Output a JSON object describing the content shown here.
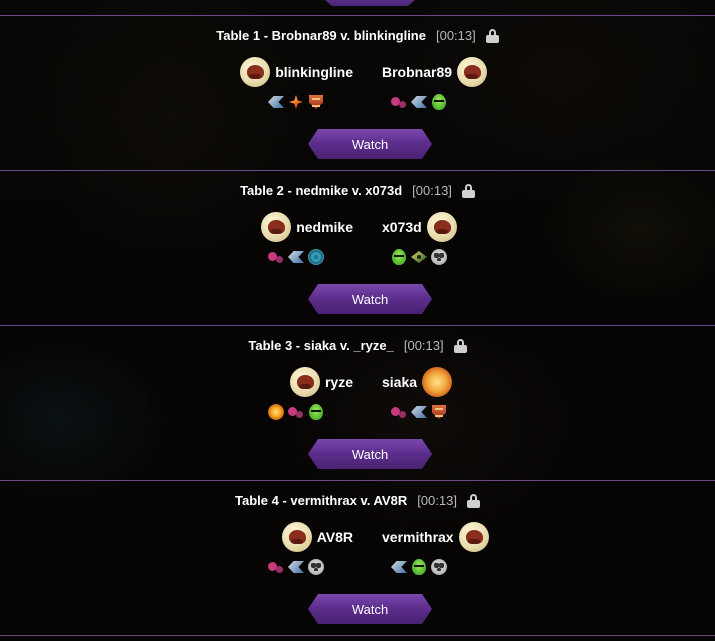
{
  "tables": [
    {
      "title": "Table 1 - Brobnar89 v. blinkingline",
      "timer": "[00:13]",
      "left_player": {
        "name": "blinkingline",
        "factions": [
          "robot",
          "ninja",
          "dino"
        ]
      },
      "right_player": {
        "name": "Brobnar89",
        "factions": [
          "zombie",
          "robot",
          "alien"
        ]
      },
      "watch_label": "Watch"
    },
    {
      "title": "Table 2 - nedmike v. x073d",
      "timer": "[00:13]",
      "left_player": {
        "name": "nedmike",
        "factions": [
          "zombie",
          "robot",
          "spiral"
        ]
      },
      "right_player": {
        "name": "x073d",
        "factions": [
          "alien",
          "eye",
          "ghost"
        ]
      },
      "watch_label": "Watch"
    },
    {
      "title": "Table 3 - siaka v. _ryze_",
      "timer": "[00:13]",
      "left_player": {
        "name": "ryze",
        "factions": [
          "sun",
          "zombie",
          "alien"
        ]
      },
      "right_player": {
        "name": "siaka",
        "factions": [
          "zombie",
          "robot",
          "dino"
        ]
      },
      "watch_label": "Watch"
    },
    {
      "title": "Table 4 - vermithrax v. AV8R",
      "timer": "[00:13]",
      "left_player": {
        "name": "AV8R",
        "factions": [
          "zombie",
          "robot",
          "ghost"
        ]
      },
      "right_player": {
        "name": "vermithrax",
        "factions": [
          "robot",
          "alien",
          "ghost"
        ]
      },
      "watch_label": "Watch"
    }
  ],
  "icons": {
    "lock": "lock-icon",
    "avatar": "player-avatar"
  },
  "colors": {
    "accent": "#6a3c9a",
    "divider": "#6a4a8c",
    "timer": "#b9b9b9"
  }
}
